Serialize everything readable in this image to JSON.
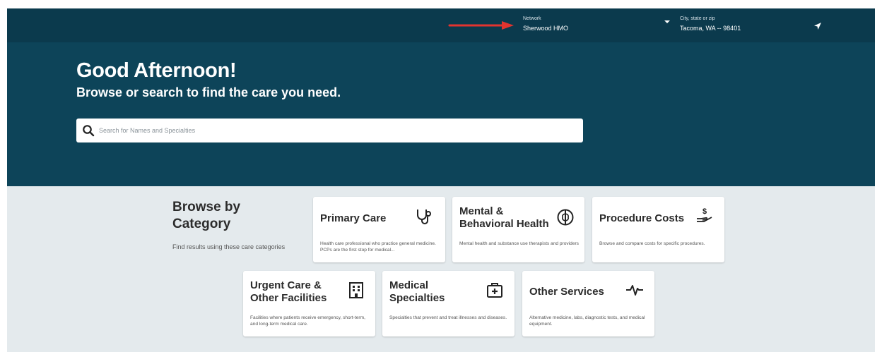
{
  "header": {
    "network_label": "Network",
    "network_value": "Sherwood HMO",
    "location_label": "City, state or zip",
    "location_value": "Tacoma, WA -- 98401",
    "annotation_arrow_color": "#e3342f"
  },
  "hero": {
    "greeting": "Good Afternoon!",
    "subtitle": "Browse or search to find the care you need.",
    "search_placeholder": "Search for Names and Specialties"
  },
  "browse": {
    "title": "Browse by Category",
    "subtitle": "Find results using these care categories"
  },
  "categories": [
    {
      "title": "Primary Care",
      "description": "Health care professional who practice general medicine. PCPs are the first stop for medical...",
      "icon": "stethoscope-icon"
    },
    {
      "title": "Mental & Behavioral Health",
      "description": "Mental health and substance use therapists and providers",
      "icon": "brain-icon"
    },
    {
      "title": "Procedure Costs",
      "description": "Browse and compare costs for specific procedures.",
      "icon": "dollar-hand-icon"
    },
    {
      "title": "Urgent Care & Other Facilities",
      "description": "Facilities where patients receive emergency, short-term, and long-term medical care.",
      "icon": "building-icon"
    },
    {
      "title": "Medical Specialties",
      "description": "Specialties that prevent and treat illnesses and diseases.",
      "icon": "medical-kit-icon"
    },
    {
      "title": "Other Services",
      "description": "Alternative medicine, labs, diagnostic tests, and medical equipment.",
      "icon": "pulse-icon"
    }
  ],
  "colors": {
    "topbar": "#0b3a4d",
    "hero": "#0d4459",
    "content_bg": "#e4eaed"
  }
}
